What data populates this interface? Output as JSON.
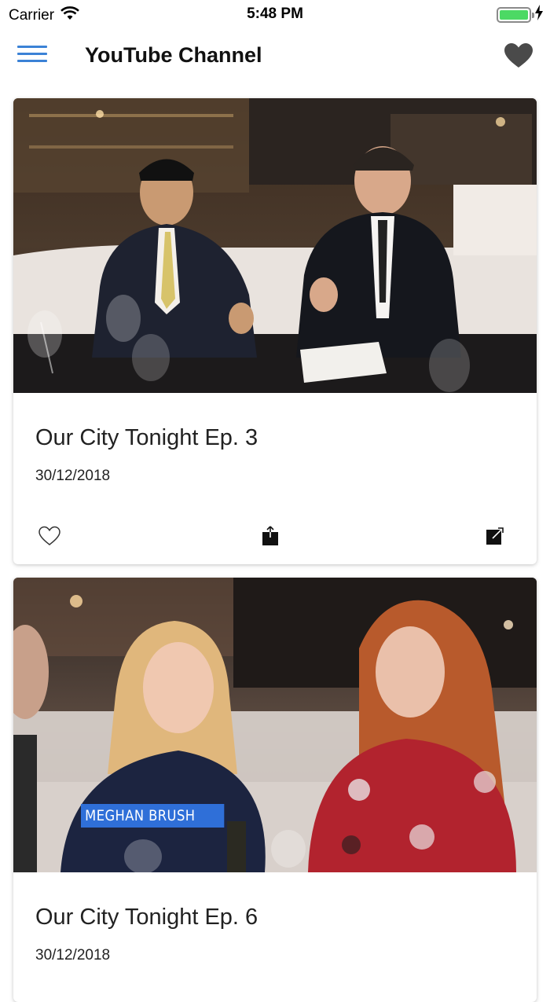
{
  "status_bar": {
    "carrier": "Carrier",
    "time": "5:48 PM",
    "battery_level": 1.0
  },
  "nav": {
    "title": "YouTube Channel",
    "menu_icon": "hamburger-menu-icon",
    "favorites_icon": "heart-filled-icon"
  },
  "videos": [
    {
      "title": "Our City Tonight Ep. 3",
      "date": "30/12/2018",
      "actions": [
        "heart-outline-icon",
        "share-icon",
        "open-external-icon"
      ]
    },
    {
      "title": "Our City Tonight Ep. 6",
      "date": "30/12/2018",
      "caption_overlay": "MEGHAN BRUSH"
    }
  ],
  "colors": {
    "accent": "#3b82d6",
    "battery": "#4cd964",
    "nameplate": "#2f6fd8"
  }
}
